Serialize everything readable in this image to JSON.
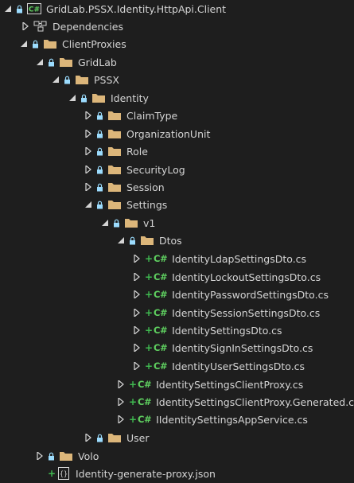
{
  "tree": {
    "project": "GridLab.PSSX.Identity.HttpApi.Client",
    "dependencies": "Dependencies",
    "client_proxies": "ClientProxies",
    "gridlab": "GridLab",
    "pssx": "PSSX",
    "identity": "Identity",
    "claim_type": "ClaimType",
    "organization_unit": "OrganizationUnit",
    "role": "Role",
    "security_log": "SecurityLog",
    "session": "Session",
    "settings": "Settings",
    "v1": "v1",
    "dtos": "Dtos",
    "dto_files": [
      "IdentityLdapSettingsDto.cs",
      "IdentityLockoutSettingsDto.cs",
      "IdentityPasswordSettingsDto.cs",
      "IdentitySessionSettingsDto.cs",
      "IdentitySettingsDto.cs",
      "IdentitySignInSettingsDto.cs",
      "IdentityUserSettingsDto.cs"
    ],
    "v1_files": [
      "IdentitySettingsClientProxy.cs",
      "IdentitySettingsClientProxy.Generated.cs",
      "IIdentitySettingsAppService.cs"
    ],
    "user": "User",
    "volo": "Volo",
    "json_file": "Identity-generate-proxy.json",
    "csharp_badge": "C#",
    "added_marker": "+"
  },
  "colors": {
    "background": "#1e1e1e",
    "text": "#d4d4d4",
    "folder": "#dcb67a",
    "lock": "#9cdcfe",
    "added": "#3fb950",
    "csharp": "#5fd060"
  },
  "icons": {
    "project": "csharp-project-icon",
    "dependencies": "dependencies-icon",
    "folder": "folder-icon",
    "lock": "lock-icon",
    "json": "json-file-icon"
  }
}
